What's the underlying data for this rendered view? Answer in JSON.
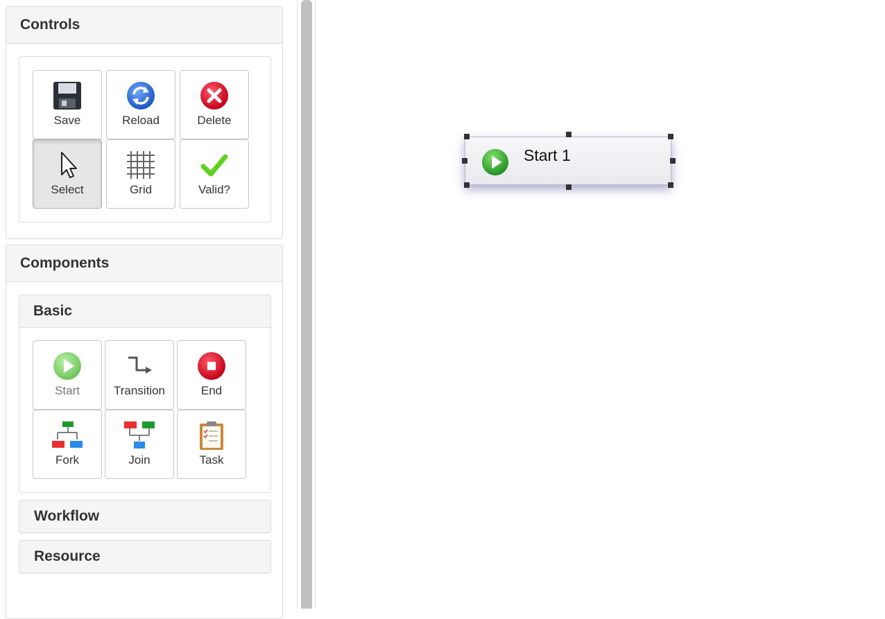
{
  "controls": {
    "title": "Controls",
    "buttons": [
      {
        "label": "Save",
        "icon": "save-icon"
      },
      {
        "label": "Reload",
        "icon": "reload-icon"
      },
      {
        "label": "Delete",
        "icon": "delete-icon"
      },
      {
        "label": "Select",
        "icon": "cursor-icon",
        "active": true
      },
      {
        "label": "Grid",
        "icon": "grid-icon"
      },
      {
        "label": "Valid?",
        "icon": "checkmark-icon"
      }
    ]
  },
  "components": {
    "title": "Components",
    "basic": {
      "title": "Basic",
      "items": [
        {
          "label": "Start",
          "icon": "start-icon",
          "disabled": true
        },
        {
          "label": "Transition",
          "icon": "transition-icon"
        },
        {
          "label": "End",
          "icon": "end-icon"
        },
        {
          "label": "Fork",
          "icon": "fork-icon"
        },
        {
          "label": "Join",
          "icon": "join-icon"
        },
        {
          "label": "Task",
          "icon": "task-icon"
        }
      ]
    },
    "workflow": {
      "title": "Workflow"
    },
    "resource": {
      "title": "Resource"
    }
  },
  "canvas": {
    "nodes": [
      {
        "label": "Start 1",
        "icon": "play-icon",
        "selected": true
      }
    ]
  },
  "colors": {
    "panel_header_bg": "#f5f5f5",
    "border": "#dcdcdc",
    "start_green": "#3aa83a",
    "end_red": "#e8102a",
    "reload_blue": "#2f6fd6"
  }
}
